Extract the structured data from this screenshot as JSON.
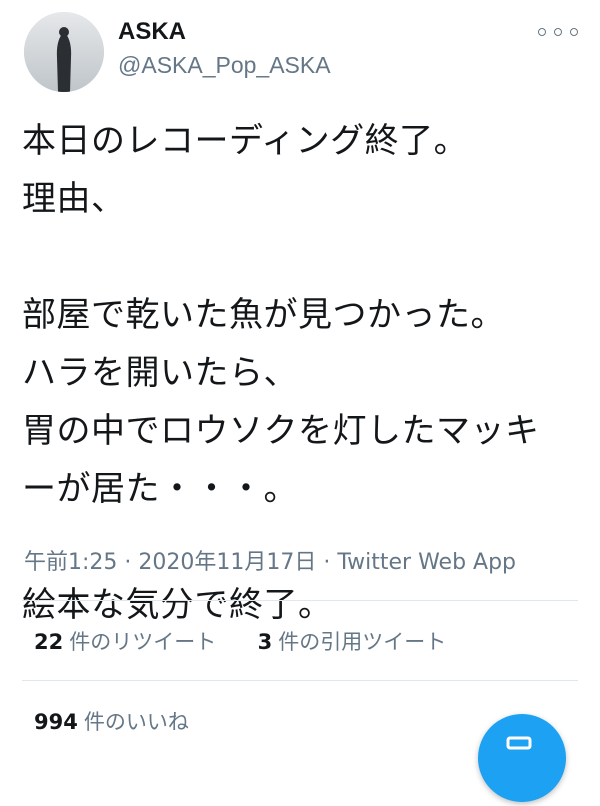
{
  "user": {
    "name": "ASKA",
    "handle": "@ASKA_Pop_ASKA"
  },
  "tweet": {
    "lines": [
      "本日のレコーディング終了。",
      "理由、",
      "",
      "部屋で乾いた魚が見つかった。",
      "ハラを開いたら、",
      "胃の中でロウソクを灯したマッキ",
      "ーが居た・・・。",
      "",
      "絵本な気分で終了。"
    ]
  },
  "meta": {
    "time": "午前1:25",
    "sep1": " · ",
    "date": "2020年11月17日",
    "sep2": " · ",
    "client": "Twitter Web App"
  },
  "stats": {
    "retweets_count": "22",
    "retweets_label": "件のリツイート",
    "quotes_count": "3",
    "quotes_label": "件の引用ツイート",
    "likes_count": "994",
    "likes_label": "件のいいね"
  },
  "colors": {
    "accent": "#1da1f2",
    "secondary_text": "#657786",
    "primary_text": "#14171a"
  },
  "icons": {
    "more": "more-options-icon",
    "compose": "compose-icon"
  }
}
